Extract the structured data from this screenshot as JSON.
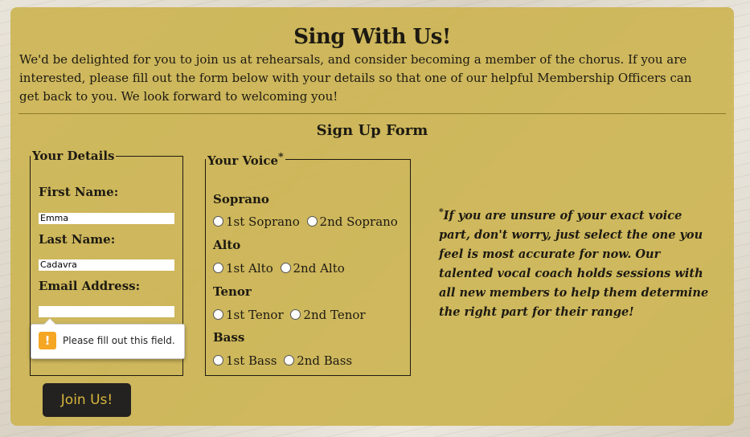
{
  "page": {
    "title": "Sing With Us!",
    "intro": "We'd be delighted for you to join us at rehearsals, and consider becoming a member of the chorus. If you are interested, please fill out the form below with your details so that one of our helpful Membership Officers can get back to you. We look forward to welcoming you!"
  },
  "form": {
    "title": "Sign Up Form",
    "details": {
      "legend": "Your Details",
      "first_name_label": "First Name:",
      "first_name_value": "Emma",
      "last_name_label": "Last Name:",
      "last_name_value": "Cadavra",
      "email_label": "Email Address:",
      "email_value": ""
    },
    "validation_tooltip": "Please fill out this field.",
    "voice": {
      "legend": "Your Voice",
      "legend_mark": "*",
      "groups": [
        {
          "name": "Soprano",
          "options": [
            "1st Soprano",
            "2nd Soprano"
          ]
        },
        {
          "name": "Alto",
          "options": [
            "1st Alto",
            "2nd Alto"
          ]
        },
        {
          "name": "Tenor",
          "options": [
            "1st Tenor",
            "2nd Tenor"
          ]
        },
        {
          "name": "Bass",
          "options": [
            "1st Bass",
            "2nd Bass"
          ]
        }
      ]
    },
    "note_mark": "*",
    "note": "If you are unsure of your exact voice part, don't worry, just select the one you feel is most accurate for now. Our talented vocal coach holds sessions with all new members to help them determine the right part for their range!",
    "submit_label": "Join Us!"
  },
  "colors": {
    "panel": "#ccb450",
    "button_bg": "#232220",
    "button_text": "#d8b63c",
    "warning": "#f5a623"
  }
}
